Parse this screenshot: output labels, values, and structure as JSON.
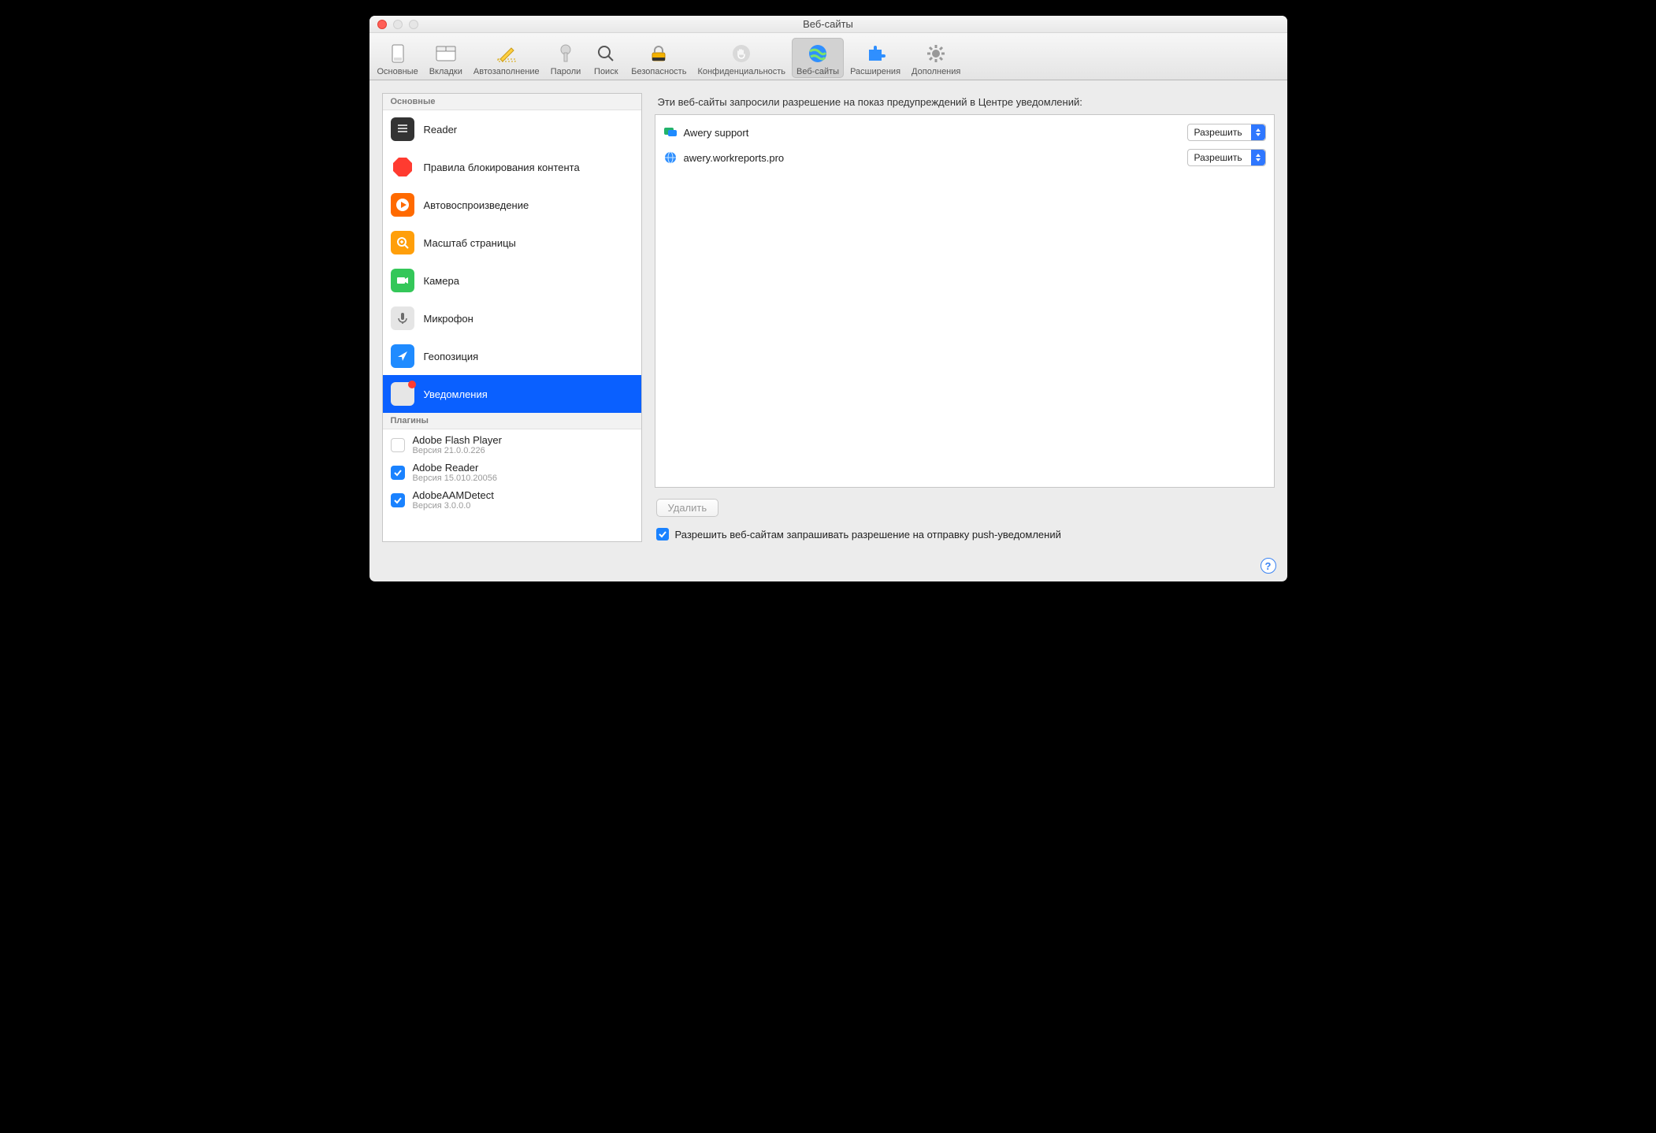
{
  "window": {
    "title": "Веб-сайты"
  },
  "toolbar": {
    "items": [
      {
        "label": "Основные"
      },
      {
        "label": "Вкладки"
      },
      {
        "label": "Автозаполнение"
      },
      {
        "label": "Пароли"
      },
      {
        "label": "Поиск"
      },
      {
        "label": "Безопасность"
      },
      {
        "label": "Конфиденциальность"
      },
      {
        "label": "Веб-сайты"
      },
      {
        "label": "Расширения"
      },
      {
        "label": "Дополнения"
      }
    ]
  },
  "sidebar": {
    "section_general": "Основные",
    "items": [
      {
        "label": "Reader"
      },
      {
        "label": "Правила блокирования контента"
      },
      {
        "label": "Автовоспроизведение"
      },
      {
        "label": "Масштаб страницы"
      },
      {
        "label": "Камера"
      },
      {
        "label": "Микрофон"
      },
      {
        "label": "Геопозиция"
      },
      {
        "label": "Уведомления"
      }
    ],
    "section_plugins": "Плагины",
    "plugins": [
      {
        "name": "Adobe Flash Player",
        "version": "Версия 21.0.0.226",
        "checked": false
      },
      {
        "name": "Adobe Reader",
        "version": "Версия 15.010.20056",
        "checked": true
      },
      {
        "name": "AdobeAAMDetect",
        "version": "Версия 3.0.0.0",
        "checked": true
      }
    ]
  },
  "main": {
    "heading": "Эти веб-сайты запросили разрешение на показ предупреждений в Центре уведомлений:",
    "sites": [
      {
        "name": "Awery support",
        "permission": "Разрешить",
        "icon": "chat"
      },
      {
        "name": "awery.workreports.pro",
        "permission": "Разрешить",
        "icon": "globe"
      }
    ],
    "delete_label": "Удалить",
    "allow_push_label": "Разрешить веб-сайтам запрашивать разрешение на отправку push-уведомлений"
  }
}
